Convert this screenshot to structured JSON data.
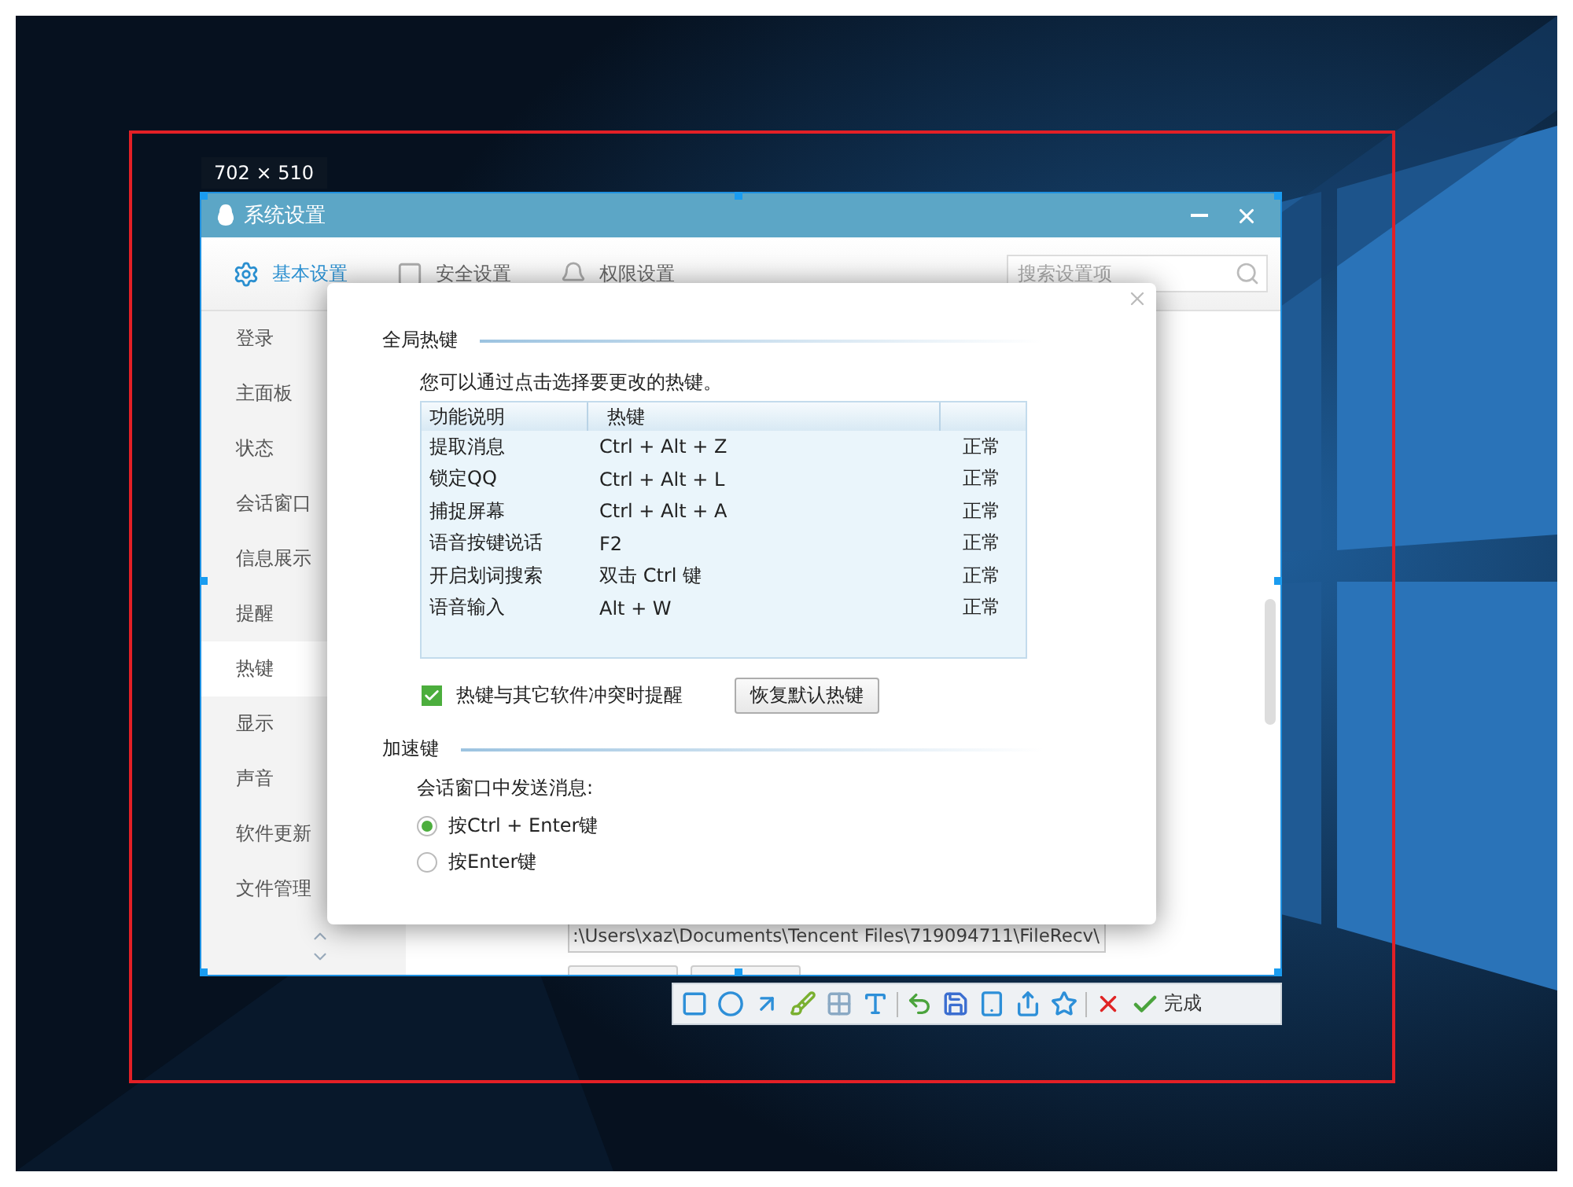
{
  "screenshot_tool": {
    "size_label": "702 × 510",
    "toolbar": {
      "done_label": "完成"
    }
  },
  "window": {
    "title": "系统设置",
    "tabs": [
      {
        "label": "基本设置",
        "selected": true
      },
      {
        "label": "安全设置",
        "selected": false
      },
      {
        "label": "权限设置",
        "selected": false
      }
    ],
    "search": {
      "placeholder": "搜索设置项"
    },
    "sidebar": {
      "items": [
        {
          "label": "登录",
          "selected": false
        },
        {
          "label": "主面板",
          "selected": false
        },
        {
          "label": "状态",
          "selected": false
        },
        {
          "label": "会话窗口",
          "selected": false
        },
        {
          "label": "信息展示",
          "selected": false
        },
        {
          "label": "提醒",
          "selected": false
        },
        {
          "label": "热键",
          "selected": true
        },
        {
          "label": "显示",
          "selected": false
        },
        {
          "label": "声音",
          "selected": false
        },
        {
          "label": "软件更新",
          "selected": false
        },
        {
          "label": "文件管理",
          "selected": false
        }
      ]
    },
    "path_field": {
      "value": ":\\Users\\xaz\\Documents\\Tencent Files\\719094711\\FileRecv\\"
    }
  },
  "dialog": {
    "global_hotkeys": {
      "title": "全局热键",
      "hint": "您可以通过点击选择要更改的热键。",
      "table": {
        "columns": [
          "功能说明",
          "热键"
        ],
        "rows": [
          {
            "function": "提取消息",
            "hotkey": "Ctrl + Alt + Z",
            "status": "正常"
          },
          {
            "function": "锁定QQ",
            "hotkey": "Ctrl + Alt + L",
            "status": "正常"
          },
          {
            "function": "捕捉屏幕",
            "hotkey": "Ctrl + Alt + A",
            "status": "正常"
          },
          {
            "function": "语音按键说话",
            "hotkey": "F2",
            "status": "正常"
          },
          {
            "function": "开启划词搜索",
            "hotkey": "双击 Ctrl 键",
            "status": "正常"
          },
          {
            "function": "语音输入",
            "hotkey": "Alt + W",
            "status": "正常"
          }
        ]
      },
      "conflict_alert": {
        "label": "热键与其它软件冲突时提醒",
        "checked": true
      },
      "restore_button": "恢复默认热键"
    },
    "accelerator": {
      "title": "加速键",
      "label": "会话窗口中发送消息:",
      "options": [
        {
          "label": "按Ctrl + Enter键",
          "selected": true
        },
        {
          "label": "按Enter键",
          "selected": false
        }
      ]
    }
  }
}
